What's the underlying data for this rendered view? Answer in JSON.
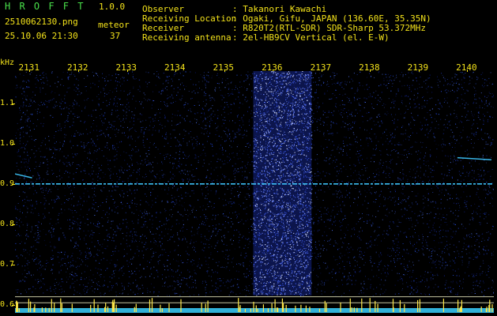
{
  "app": {
    "title": "H R O F F T",
    "version": "1.0.0",
    "filename": "2510062130.png",
    "datetime": "25.10.06 21:30",
    "count_label": "meteor",
    "count_value": "37"
  },
  "info": {
    "labels": [
      "Observer",
      "Receiving Location",
      "Receiver",
      "Receiving antenna"
    ],
    "values": [
      ": Takanori Kawachi",
      ": Ogaki, Gifu, JAPAN (136.60E, 35.35N)",
      ": R820T2(RTL-SDR) SDR-Sharp 53.372MHz",
      ": 2el-HB9CV Vertical (el. E-W)"
    ]
  },
  "chart_data": {
    "type": "heatmap",
    "ylabel": "kHz",
    "y_ticks": [
      "1.1",
      "1.0",
      "0.9",
      "0.8",
      "0.7",
      "0.6"
    ],
    "y_tick_values": [
      1.1,
      1.0,
      0.9,
      0.8,
      0.7,
      0.6
    ],
    "x_ticks": [
      "2131",
      "2132",
      "2133",
      "2134",
      "2135",
      "2136",
      "2137",
      "2138",
      "2139",
      "2140"
    ],
    "x_tick_values": [
      2131,
      2132,
      2133,
      2134,
      2135,
      2136,
      2137,
      2138,
      2139,
      2140
    ],
    "xlim": [
      2130.7,
      2140.55
    ],
    "ylim": [
      0.58,
      1.18
    ],
    "carrier_khz": 0.9,
    "burst_range": [
      2135.6,
      2136.8
    ],
    "echoes": [
      {
        "x0": 2130.7,
        "x1": 2131.05,
        "y0": 0.925,
        "y1": 0.915
      },
      {
        "x0": 2139.8,
        "x1": 2140.5,
        "y0": 0.965,
        "y1": 0.96
      }
    ],
    "marker_lines_khz": [
      0.62,
      0.605
    ],
    "colors": {
      "axis": "#f2e11a",
      "carrier": "#3fc8ff",
      "noise": "#1a2fb0",
      "marker": "#e8e8c0",
      "meter": "#ffe94a"
    }
  }
}
